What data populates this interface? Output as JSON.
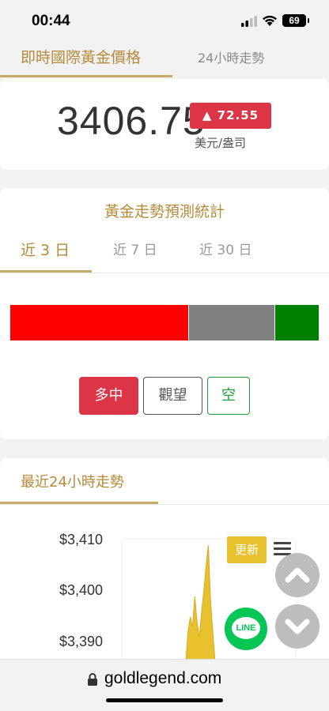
{
  "status_bar": {
    "time": "00:44",
    "battery": "69"
  },
  "top_tabs": [
    {
      "label": "即時國際黃金價格"
    },
    {
      "label": "24小時走勢"
    }
  ],
  "price": {
    "value": "3406.75",
    "change": "▲ 72.55",
    "unit": "美元/盎司"
  },
  "forecast": {
    "title": "黃金走勢預測統計",
    "tabs": [
      {
        "label": "近 3 日"
      },
      {
        "label": "近 7 日"
      },
      {
        "label": "近 30 日"
      }
    ],
    "bar_shares": {
      "long": 0.58,
      "wait": 0.28,
      "short": 0.14
    },
    "buttons": {
      "long": "多中",
      "wait": "觀望",
      "short": "空"
    }
  },
  "trend": {
    "title": "最近24小時走勢",
    "update_label": "更新",
    "chart_data": {
      "type": "area",
      "ylabels": [
        "$3,410",
        "$3,400",
        "$3,390"
      ],
      "y": [
        3385,
        3386,
        3392,
        3395,
        3393,
        3399,
        3394,
        3391,
        3396,
        3400,
        3405,
        3409,
        3398,
        3392,
        3386
      ],
      "ylim": [
        3384,
        3412
      ],
      "color": "#e8c22e"
    }
  },
  "fab": {
    "line_label": "LINE"
  },
  "browser": {
    "url": "goldlegend.com"
  }
}
